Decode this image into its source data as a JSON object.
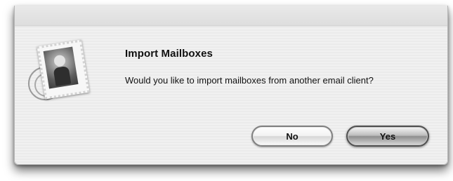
{
  "dialog": {
    "title": "Import Mailboxes",
    "message": "Would you like to import mailboxes from another email client?",
    "icon": "mail-stamp-icon"
  },
  "buttons": {
    "no_label": "No",
    "yes_label": "Yes",
    "default": "Yes"
  }
}
